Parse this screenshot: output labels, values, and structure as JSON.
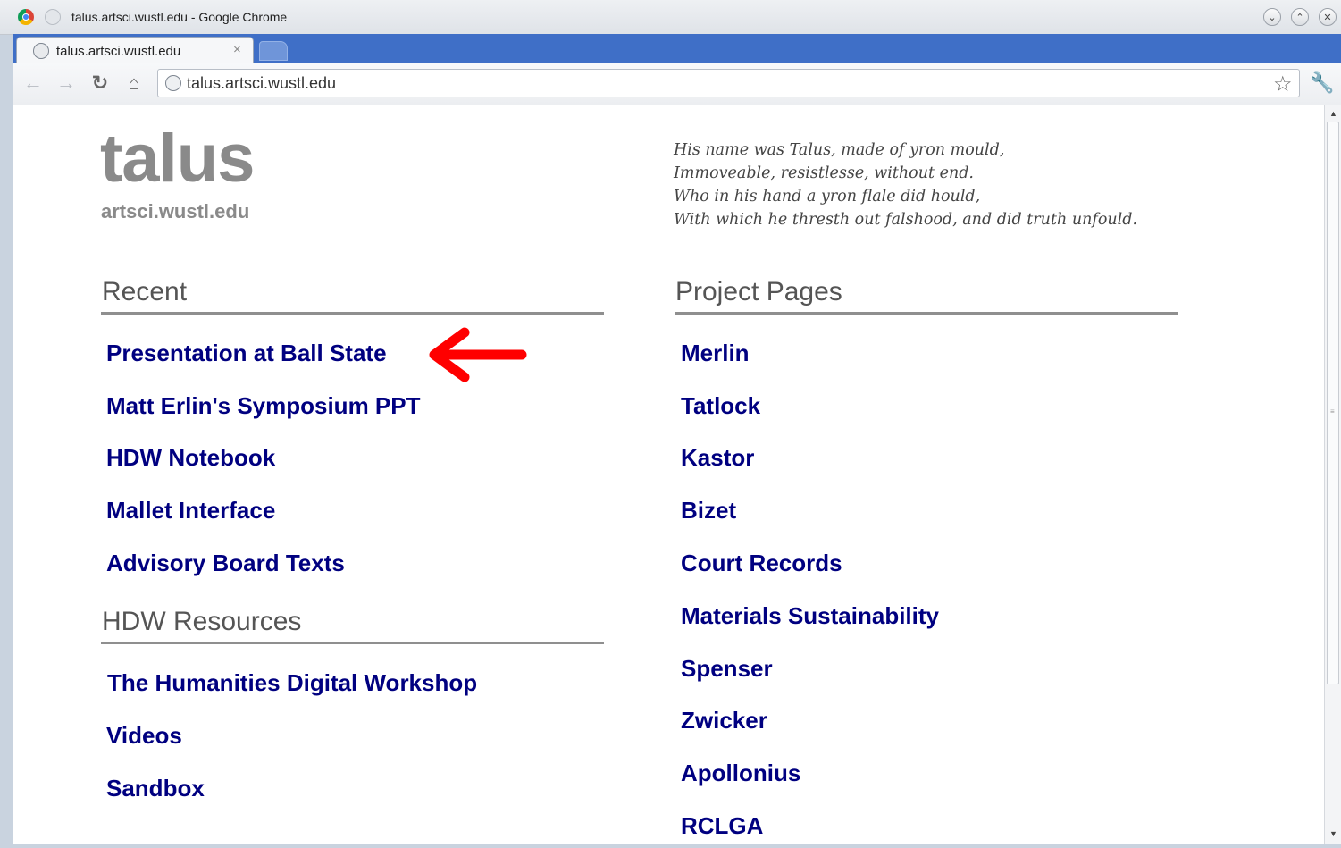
{
  "window": {
    "title": "talus.artsci.wustl.edu - Google Chrome",
    "controls": [
      "minimize",
      "maximize",
      "close"
    ]
  },
  "browser": {
    "tab_title": "talus.artsci.wustl.edu",
    "tab_close": "×",
    "url": "talus.artsci.wustl.edu"
  },
  "page": {
    "site_title": "talus",
    "site_subtitle": "artsci.wustl.edu",
    "poem": [
      "His name was Talus, made of yron mould,",
      "Immoveable, resistlesse, without end.",
      "Who in his hand a yron flale did hould,",
      "With which he thresth out falshood, and did truth unfould."
    ],
    "recent": {
      "heading": "Recent",
      "links": [
        "Presentation at Ball State",
        "Matt Erlin's Symposium PPT",
        "HDW Notebook",
        "Mallet Interface",
        "Advisory Board Texts"
      ]
    },
    "hdw_resources": {
      "heading": "HDW Resources",
      "links": [
        "The Humanities Digital Workshop",
        "Videos",
        "Sandbox"
      ]
    },
    "project_pages": {
      "heading": "Project Pages",
      "links": [
        "Merlin",
        "Tatlock",
        "Kastor",
        "Bizet",
        "Court Records",
        "Materials Sustainability",
        "Spenser",
        "Zwicker",
        "Apollonius",
        "RCLGA"
      ]
    }
  },
  "icons": {
    "back": "back-arrow-icon",
    "forward": "forward-arrow-icon",
    "reload": "reload-icon",
    "home": "home-icon",
    "bookmark": "star-icon",
    "menu": "wrench-icon",
    "annotation": "red-arrow-icon"
  },
  "colors": {
    "link": "#000080",
    "title_gray": "#8a8a8a",
    "tabstrip": "#3f6fc7",
    "annotation_arrow": "#ff0000"
  }
}
